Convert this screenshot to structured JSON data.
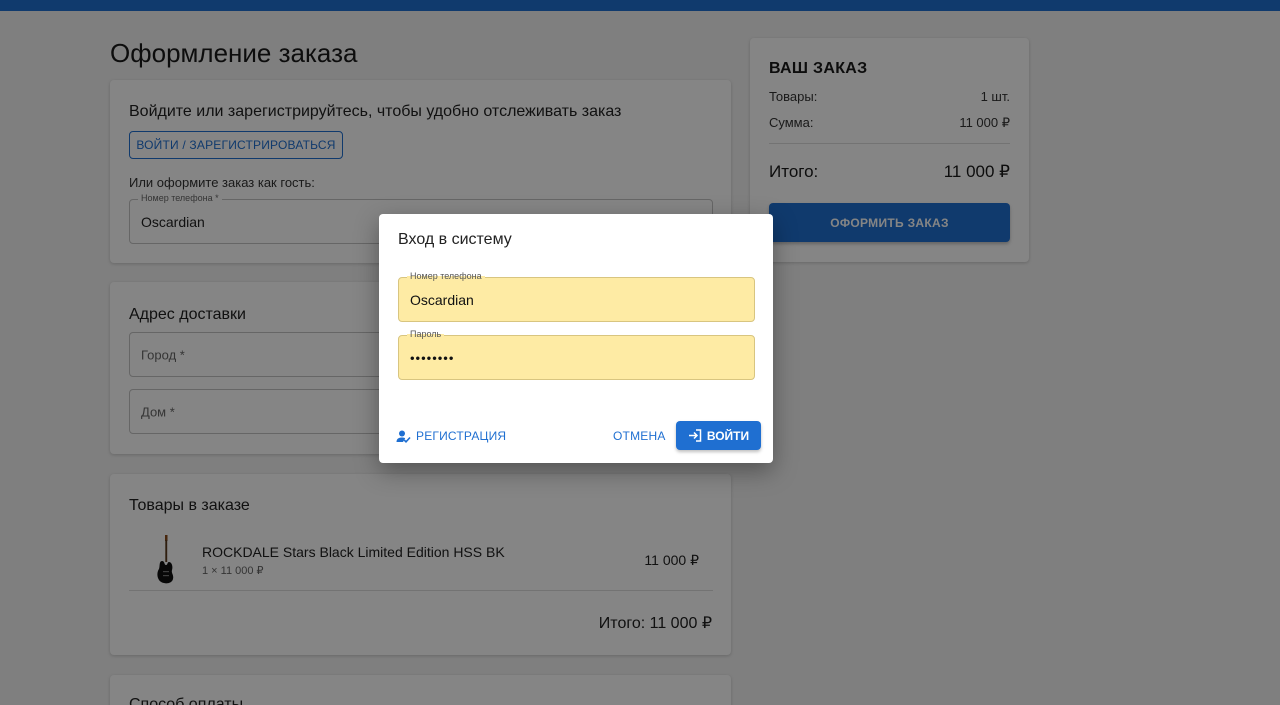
{
  "page": {
    "title": "Оформление заказа"
  },
  "login_card": {
    "heading": "Войдите или зарегистрируйтесь, чтобы удобно отслеживать заказ",
    "login_button": "ВОЙТИ / ЗАРЕГИСТРИРОВАТЬСЯ",
    "guest_text": "Или оформите заказ как гость:",
    "phone_label": "Номер телефона *",
    "phone_value": "Oscardian"
  },
  "address_card": {
    "heading": "Адрес доставки",
    "city_placeholder": "Город *",
    "house_placeholder": "Дом *"
  },
  "items_card": {
    "heading": "Товары в заказе",
    "items": [
      {
        "name": "ROCKDALE Stars Black Limited Edition HSS BK",
        "qty_line": "1 × 11 000 ₽",
        "price": "11 000 ₽",
        "icon": "guitar-icon"
      }
    ],
    "total": "Итого: 11 000 ₽"
  },
  "payment_card": {
    "heading": "Способ оплаты"
  },
  "summary": {
    "title": "ВАШ ЗАКАЗ",
    "goods_label": "Товары:",
    "goods_value": "1 шт.",
    "sum_label": "Сумма:",
    "sum_value": "11 000 ₽",
    "total_label": "Итого:",
    "total_value": "11 000 ₽",
    "order_button": "ОФОРМИТЬ ЗАКАЗ"
  },
  "dialog": {
    "title": "Вход в систему",
    "phone_label": "Номер телефона",
    "phone_value": "Oscardian",
    "password_label": "Пароль",
    "password_value": "••••••••",
    "register_button": "РЕГИСТРАЦИЯ",
    "cancel_button": "ОТМЕНА",
    "login_button": "ВОЙТИ"
  },
  "colors": {
    "accent": "#1f6fd1",
    "autofill": "#feeba4"
  }
}
